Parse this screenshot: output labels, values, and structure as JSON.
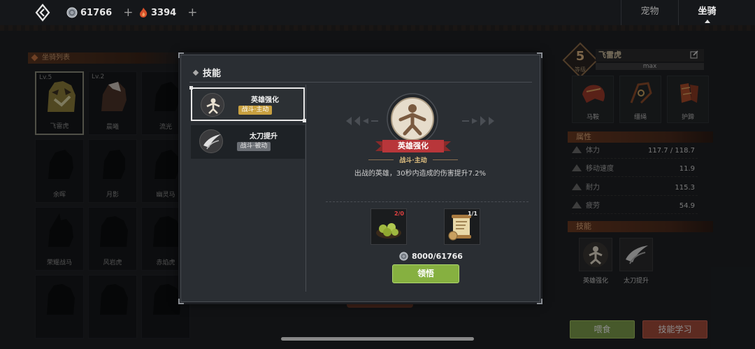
{
  "topbar": {
    "silver": "61766",
    "gems": "3394",
    "tabs": [
      {
        "label": "宠物",
        "active": false
      },
      {
        "label": "坐骑",
        "active": true
      }
    ]
  },
  "mount_list": {
    "title": "坐骑列表",
    "mounts": [
      {
        "name": "飞雷虎",
        "level": "Lv.5",
        "selected": true
      },
      {
        "name": "晨曦",
        "level": "Lv.2",
        "selected": false
      },
      {
        "name": "流光",
        "level": "",
        "selected": false
      },
      {
        "name": "余晖",
        "level": "",
        "selected": false
      },
      {
        "name": "月影",
        "level": "",
        "selected": false
      },
      {
        "name": "幽灵马",
        "level": "",
        "selected": false
      },
      {
        "name": "荣耀战马",
        "level": "",
        "selected": false
      },
      {
        "name": "风岩虎",
        "level": "",
        "selected": false
      },
      {
        "name": "赤焰虎",
        "level": "",
        "selected": false
      },
      {
        "name": "",
        "level": "",
        "selected": false
      },
      {
        "name": "",
        "level": "",
        "selected": false
      },
      {
        "name": "",
        "level": "",
        "selected": false
      }
    ]
  },
  "mount_detail": {
    "level": "5",
    "level_label": "等级",
    "name": "飞雷虎",
    "max": "max",
    "equipment": [
      {
        "label": "马鞍"
      },
      {
        "label": "缰绳"
      },
      {
        "label": "护蹄"
      }
    ],
    "attributes_title": "属性",
    "stats": [
      {
        "label": "体力",
        "value": "117.7 / 118.7"
      },
      {
        "label": "移动速度",
        "value": "11.9"
      },
      {
        "label": "耐力",
        "value": "115.3"
      },
      {
        "label": "疲劳",
        "value": "54.9"
      }
    ],
    "skills_title": "技能",
    "skills": [
      {
        "label": "英雄强化"
      },
      {
        "label": "太刀提升"
      }
    ],
    "feed_button": "喂食",
    "learn_button": "技能学习"
  },
  "modal": {
    "title": "技能",
    "skills": [
      {
        "name": "英雄强化",
        "type": "战斗·主动",
        "active": true
      },
      {
        "name": "太刀提升",
        "type": "战斗·被动",
        "active": false
      }
    ],
    "selected": {
      "name": "英雄强化",
      "type": "战斗·主动",
      "description": "出战的英雄，30秒内造成的伤害提升7.2%"
    },
    "materials": [
      {
        "count": "2/0",
        "count_color": "#e04040",
        "icon": "berries-icon"
      },
      {
        "count": "1/1",
        "count_color": "#e8e8e8",
        "icon": "scroll-icon"
      }
    ],
    "cost": "8000/61766",
    "comprehend_button": "领悟"
  }
}
